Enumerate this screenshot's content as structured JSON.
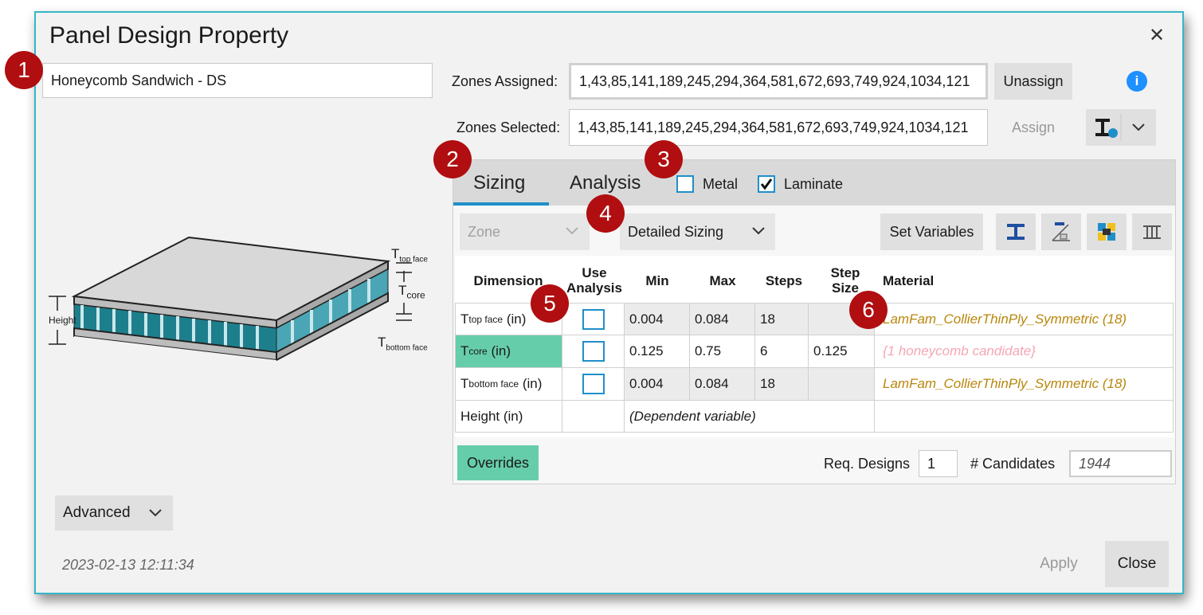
{
  "dialog": {
    "title": "Panel Design Property",
    "close_icon": "✕"
  },
  "property_name": "Honeycomb Sandwich - DS",
  "zones": {
    "assigned_label": "Zones Assigned:",
    "assigned_value": "1,43,85,141,189,245,294,364,581,672,693,749,924,1034,121",
    "selected_label": "Zones Selected:",
    "selected_value": "1,43,85,141,189,245,294,364,581,672,693,749,924,1034,121",
    "unassign_label": "Unassign",
    "assign_label": "Assign"
  },
  "diagram": {
    "top_face_T": "T",
    "top_face_sub": "top face",
    "core_T": "T",
    "core_sub": "core",
    "bottom_face_T": "T",
    "bottom_face_sub": "bottom face",
    "height_label": "Height"
  },
  "badges": [
    "1",
    "2",
    "3",
    "4",
    "5",
    "6"
  ],
  "tabs": {
    "sizing": "Sizing",
    "analysis": "Analysis"
  },
  "material_types": {
    "metal": "Metal",
    "laminate": "Laminate",
    "metal_checked": false,
    "laminate_checked": true
  },
  "toolbar": {
    "zone_dropdown": "Zone",
    "sizing_mode": "Detailed Sizing",
    "set_variables": "Set Variables"
  },
  "table": {
    "headers": {
      "dimension": "Dimension",
      "use_analysis": "Use\nAnalysis",
      "min": "Min",
      "max": "Max",
      "steps": "Steps",
      "step_size": "Step\nSize",
      "material": "Material"
    },
    "rows": [
      {
        "T": "T",
        "sub": "top face",
        "unit": "(in)",
        "min": "0.004",
        "max": "0.084",
        "steps": "18",
        "step_size": "",
        "material": "LamFam_CollierThinPly_Symmetric (18)"
      },
      {
        "T": "T",
        "sub": "core",
        "unit": "(in)",
        "min": "0.125",
        "max": "0.75",
        "steps": "6",
        "step_size": "0.125",
        "material": "{1 honeycomb candidate}"
      },
      {
        "T": "T",
        "sub": "bottom face",
        "unit": "(in)",
        "min": "0.004",
        "max": "0.084",
        "steps": "18",
        "step_size": "",
        "material": "LamFam_CollierThinPly_Symmetric (18)"
      },
      {
        "label": "Height (in)",
        "dependent": "(Dependent variable)"
      }
    ]
  },
  "footer_panel": {
    "overrides": "Overrides",
    "req_designs_label": "Req. Designs",
    "req_designs_value": "1",
    "candidates_label": "# Candidates",
    "candidates_value": "1944"
  },
  "advanced_label": "Advanced",
  "timestamp": "2023-02-13 12:11:34",
  "buttons": {
    "apply": "Apply",
    "close": "Close"
  },
  "colors": {
    "accent": "#1f8fc9",
    "badge": "#b00e10",
    "highlight": "#66cdaa",
    "material_text": "#b8860b",
    "candidate_text": "#f4a6b6"
  }
}
